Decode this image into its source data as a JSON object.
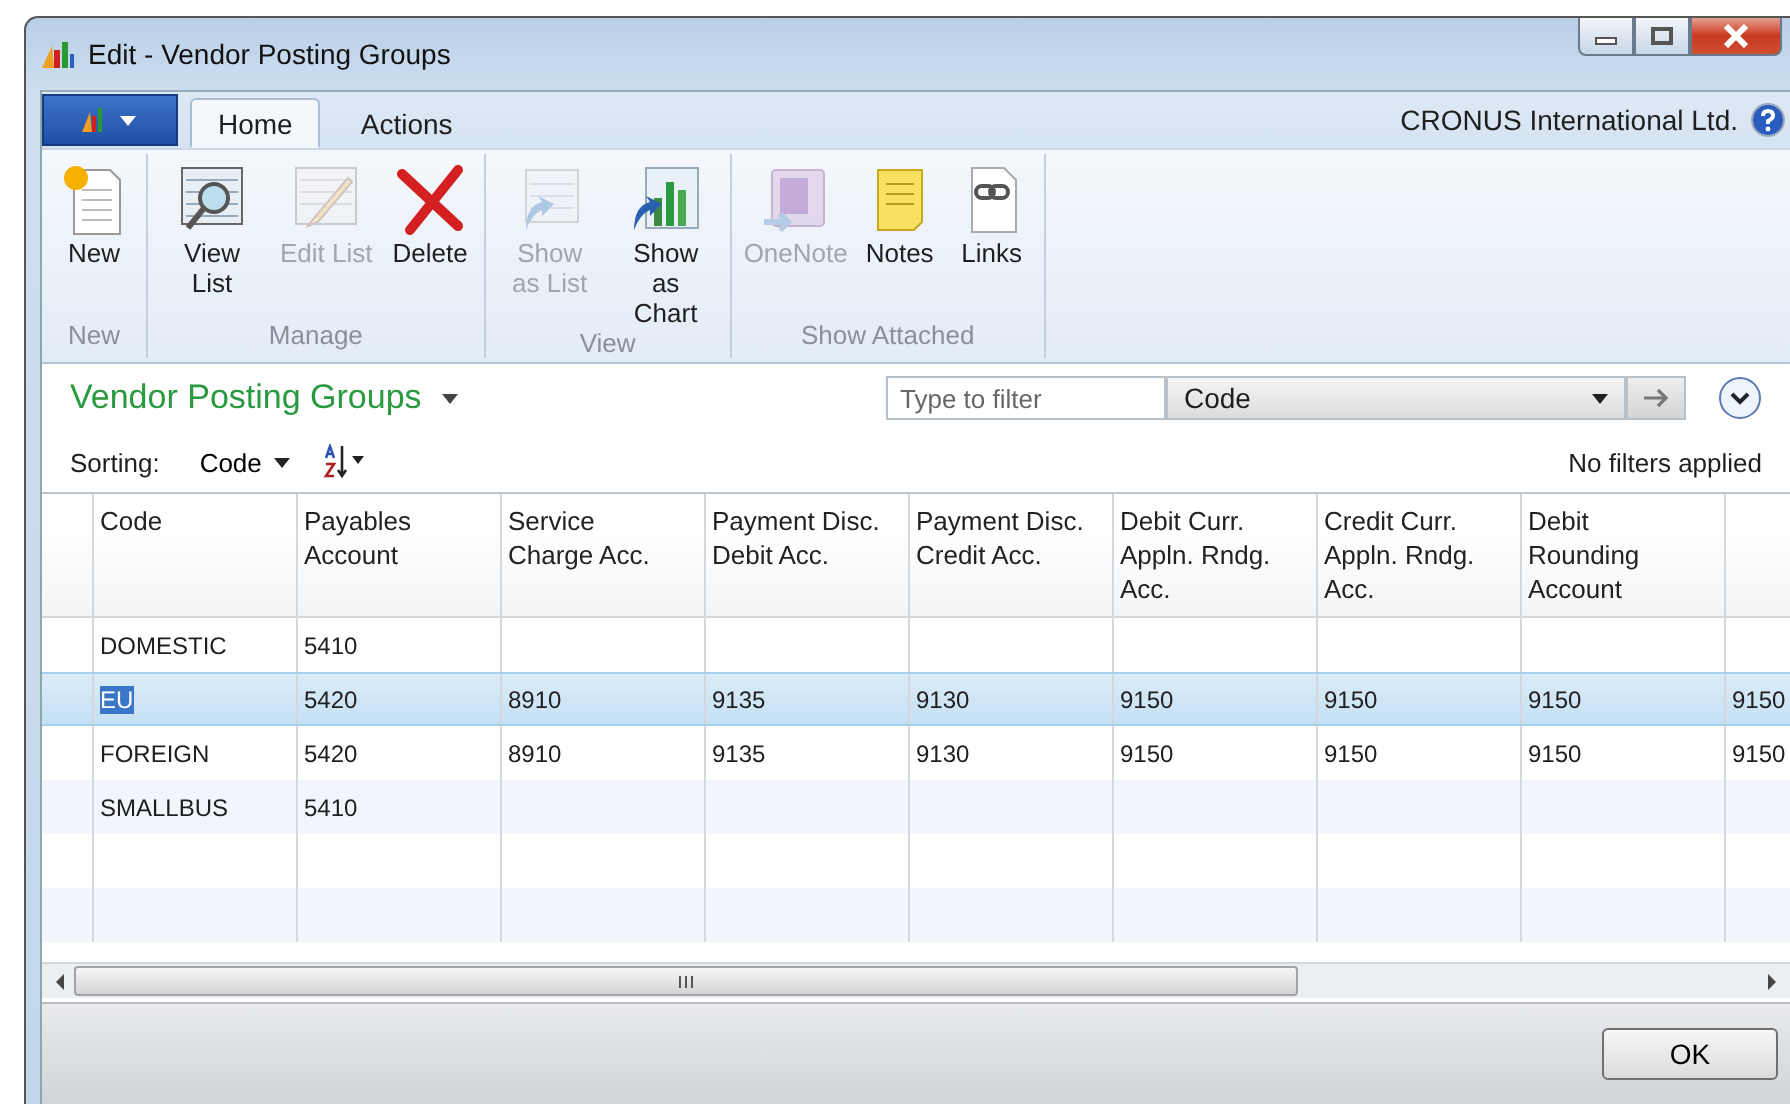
{
  "window": {
    "title": "Edit - Vendor Posting Groups"
  },
  "tabs": [
    {
      "label": "Home",
      "selected": true
    },
    {
      "label": "Actions",
      "selected": false
    }
  ],
  "company": "CRONUS International Ltd.",
  "ribbon": [
    {
      "label": "New",
      "items": [
        {
          "label": "New",
          "disabled": false
        }
      ]
    },
    {
      "label": "Manage",
      "items": [
        {
          "label": "View List",
          "disabled": false
        },
        {
          "label": "Edit List",
          "disabled": true
        },
        {
          "label": "Delete",
          "disabled": false
        }
      ]
    },
    {
      "label": "View",
      "items": [
        {
          "label": "Show as List",
          "disabled": true
        },
        {
          "label": "Show as Chart",
          "disabled": false
        }
      ]
    },
    {
      "label": "Show Attached",
      "items": [
        {
          "label": "OneNote",
          "disabled": true
        },
        {
          "label": "Notes",
          "disabled": false
        },
        {
          "label": "Links",
          "disabled": false
        }
      ]
    }
  ],
  "page": {
    "title": "Vendor Posting Groups",
    "filter": {
      "placeholder": "Type to filter",
      "field": "Code"
    },
    "sorting_label": "Sorting:",
    "sorting": "Code",
    "filter_status": "No filters applied"
  },
  "table": {
    "columns": [
      "Code",
      "Payables Account",
      "Service Charge Acc.",
      "Payment Disc. Debit Acc.",
      "Payment Disc. Credit Acc.",
      "Debit Curr. Appln. Rndg. Acc.",
      "Credit Curr. Appln. Rndg. Acc.",
      "Debit Rounding Account"
    ],
    "rows": [
      {
        "selected": false,
        "cells": [
          "DOMESTIC",
          "5410",
          "",
          "",
          "",
          "",
          "",
          "",
          ""
        ]
      },
      {
        "selected": true,
        "cells": [
          "EU",
          "5420",
          "8910",
          "9135",
          "9130",
          "9150",
          "9150",
          "9150",
          "9150"
        ]
      },
      {
        "selected": false,
        "cells": [
          "FOREIGN",
          "5420",
          "8910",
          "9135",
          "9130",
          "9150",
          "9150",
          "9150",
          "9150"
        ]
      },
      {
        "selected": false,
        "cells": [
          "SMALLBUS",
          "5410",
          "",
          "",
          "",
          "",
          "",
          "",
          ""
        ]
      }
    ]
  },
  "buttons": [
    "OK"
  ]
}
